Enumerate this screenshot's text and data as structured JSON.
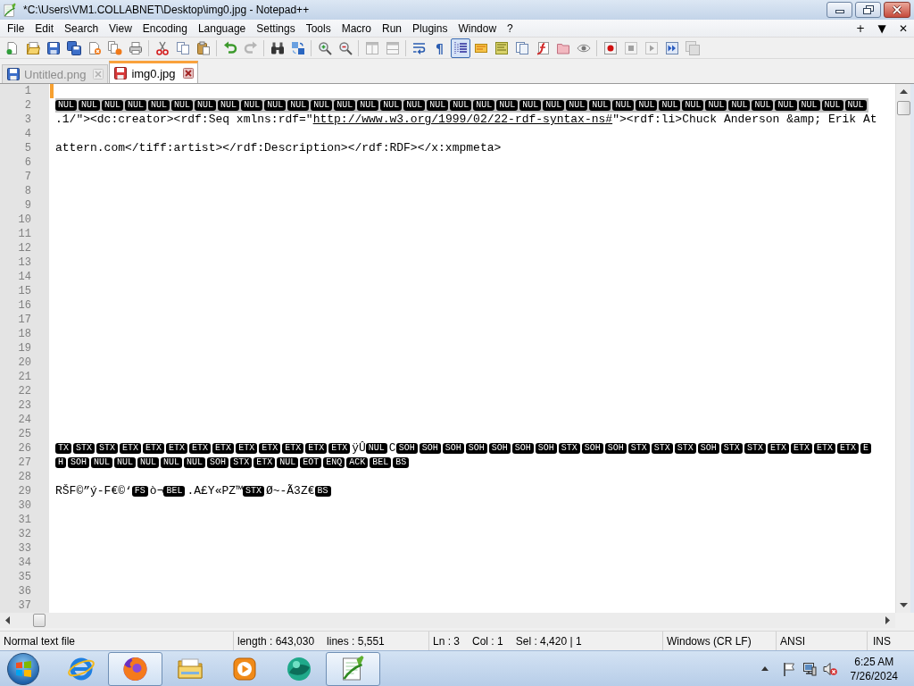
{
  "window": {
    "title": "*C:\\Users\\VM1.COLLABNET\\Desktop\\img0.jpg - Notepad++"
  },
  "menu": {
    "items": [
      "File",
      "Edit",
      "Search",
      "View",
      "Encoding",
      "Language",
      "Settings",
      "Tools",
      "Macro",
      "Run",
      "Plugins",
      "Window",
      "?"
    ],
    "buttons": [
      "+",
      "▼",
      "✕"
    ]
  },
  "toolbar": {
    "groups": [
      {
        "items": [
          {
            "kind": "new",
            "pressed": false,
            "disabled": false
          },
          {
            "kind": "open",
            "pressed": false,
            "disabled": false
          },
          {
            "kind": "save",
            "pressed": false,
            "disabled": false
          },
          {
            "kind": "save_all",
            "pressed": false,
            "disabled": false
          },
          {
            "kind": "close",
            "pressed": false,
            "disabled": false
          },
          {
            "kind": "close_all",
            "pressed": false,
            "disabled": false
          },
          {
            "kind": "print",
            "pressed": false,
            "disabled": false
          }
        ]
      },
      {
        "items": [
          {
            "kind": "cut",
            "pressed": false,
            "disabled": false
          },
          {
            "kind": "copy",
            "pressed": false,
            "disabled": false
          },
          {
            "kind": "paste",
            "pressed": false,
            "disabled": false
          }
        ]
      },
      {
        "items": [
          {
            "kind": "undo",
            "pressed": false,
            "disabled": false
          },
          {
            "kind": "redo",
            "pressed": false,
            "disabled": true
          }
        ]
      },
      {
        "items": [
          {
            "kind": "find",
            "pressed": false,
            "disabled": false
          },
          {
            "kind": "replace",
            "pressed": false,
            "disabled": false
          }
        ]
      },
      {
        "items": [
          {
            "kind": "zoom_in",
            "pressed": false,
            "disabled": false
          },
          {
            "kind": "zoom_out",
            "pressed": false,
            "disabled": false
          }
        ]
      },
      {
        "items": [
          {
            "kind": "sync_v",
            "pressed": false,
            "disabled": true
          },
          {
            "kind": "sync_h",
            "pressed": false,
            "disabled": true
          }
        ]
      },
      {
        "items": [
          {
            "kind": "wrap",
            "pressed": false,
            "disabled": false
          },
          {
            "kind": "glyph",
            "glyph": "¶",
            "pressed": false,
            "disabled": false
          },
          {
            "kind": "indent",
            "pressed": true,
            "disabled": false
          },
          {
            "kind": "udl",
            "pressed": false,
            "disabled": false
          },
          {
            "kind": "doc_map",
            "pressed": false,
            "disabled": false
          },
          {
            "kind": "doc_list",
            "pressed": false,
            "disabled": false
          },
          {
            "kind": "func_list",
            "pressed": false,
            "disabled": false
          },
          {
            "kind": "folder_ws",
            "pressed": false,
            "disabled": false
          },
          {
            "kind": "monitor",
            "pressed": false,
            "disabled": false
          }
        ]
      },
      {
        "items": [
          {
            "kind": "record",
            "pressed": false,
            "disabled": false
          },
          {
            "kind": "stop",
            "pressed": false,
            "disabled": true
          },
          {
            "kind": "play",
            "pressed": false,
            "disabled": true
          },
          {
            "kind": "play_multi",
            "pressed": false,
            "disabled": false
          },
          {
            "kind": "save_macro",
            "pressed": false,
            "disabled": true
          }
        ]
      }
    ]
  },
  "tabs": [
    {
      "label": "Untitled.png",
      "selected": false,
      "modified": false
    },
    {
      "label": "img0.jpg",
      "selected": true,
      "modified": true
    }
  ],
  "lines": [
    {
      "number": "1",
      "selected": false,
      "modified": true
    },
    {
      "number": "2",
      "selected": true,
      "modified": false,
      "segments": [
        {
          "kind": "control",
          "text": "NUL"
        },
        {
          "kind": "control",
          "text": "NUL"
        },
        {
          "kind": "control",
          "text": "NUL"
        },
        {
          "kind": "control",
          "text": "NUL"
        },
        {
          "kind": "control",
          "text": "NUL"
        },
        {
          "kind": "control",
          "text": "NUL"
        },
        {
          "kind": "control",
          "text": "NUL"
        },
        {
          "kind": "control",
          "text": "NUL"
        },
        {
          "kind": "control",
          "text": "NUL"
        },
        {
          "kind": "control",
          "text": "NUL"
        },
        {
          "kind": "control",
          "text": "NUL"
        },
        {
          "kind": "control",
          "text": "NUL"
        },
        {
          "kind": "control",
          "text": "NUL"
        },
        {
          "kind": "control",
          "text": "NUL"
        },
        {
          "kind": "control",
          "text": "NUL"
        },
        {
          "kind": "control",
          "text": "NUL"
        },
        {
          "kind": "control",
          "text": "NUL"
        },
        {
          "kind": "control",
          "text": "NUL"
        },
        {
          "kind": "control",
          "text": "NUL"
        },
        {
          "kind": "control",
          "text": "NUL"
        },
        {
          "kind": "control",
          "text": "NUL"
        },
        {
          "kind": "control",
          "text": "NUL"
        },
        {
          "kind": "control",
          "text": "NUL"
        },
        {
          "kind": "control",
          "text": "NUL"
        },
        {
          "kind": "control",
          "text": "NUL"
        },
        {
          "kind": "control",
          "text": "NUL"
        },
        {
          "kind": "control",
          "text": "NUL"
        },
        {
          "kind": "control",
          "text": "NUL"
        },
        {
          "kind": "control",
          "text": "NUL"
        },
        {
          "kind": "control",
          "text": "NUL"
        },
        {
          "kind": "control",
          "text": "NUL"
        },
        {
          "kind": "control",
          "text": "NUL"
        },
        {
          "kind": "control",
          "text": "NUL"
        },
        {
          "kind": "control",
          "text": "NUL"
        },
        {
          "kind": "control",
          "text": "NUL"
        }
      ]
    },
    {
      "number": "3",
      "selected": false,
      "modified": false,
      "segments": [
        {
          "kind": "text",
          "text": ".1/\"><dc:creator><rdf:Seq xmlns:rdf=\""
        },
        {
          "kind": "link",
          "text": "http://www.w3.org/1999/02/22-rdf-syntax-ns#"
        },
        {
          "kind": "text",
          "text": "\"><rdf:li>Chuck Anderson &amp; Erik At"
        }
      ]
    },
    {
      "number": "4",
      "selected": false,
      "modified": false
    },
    {
      "number": "5",
      "selected": false,
      "modified": false,
      "segments": [
        {
          "kind": "text",
          "text": "attern.com</tiff:artist></rdf:Description></rdf:RDF></x:xmpmeta>"
        }
      ]
    },
    {
      "number": "6",
      "selected": false,
      "modified": false
    },
    {
      "number": "7",
      "selected": false,
      "modified": false
    },
    {
      "number": "8",
      "selected": false,
      "modified": false
    },
    {
      "number": "9",
      "selected": false,
      "modified": false
    },
    {
      "number": "10",
      "selected": false,
      "modified": false
    },
    {
      "number": "11",
      "selected": false,
      "modified": false
    },
    {
      "number": "12",
      "selected": false,
      "modified": false
    },
    {
      "number": "13",
      "selected": false,
      "modified": false
    },
    {
      "number": "14",
      "selected": false,
      "modified": false
    },
    {
      "number": "15",
      "selected": false,
      "modified": false
    },
    {
      "number": "16",
      "selected": false,
      "modified": false
    },
    {
      "number": "17",
      "selected": false,
      "modified": false
    },
    {
      "number": "18",
      "selected": false,
      "modified": false
    },
    {
      "number": "19",
      "selected": false,
      "modified": false
    },
    {
      "number": "20",
      "selected": false,
      "modified": false
    },
    {
      "number": "21",
      "selected": false,
      "modified": false
    },
    {
      "number": "22",
      "selected": false,
      "modified": false
    },
    {
      "number": "23",
      "selected": false,
      "modified": false
    },
    {
      "number": "24",
      "selected": false,
      "modified": false
    },
    {
      "number": "25",
      "selected": false,
      "modified": false
    },
    {
      "number": "26",
      "selected": false,
      "modified": false,
      "segments": [
        {
          "kind": "control",
          "text": "TX"
        },
        {
          "kind": "control",
          "text": "STX"
        },
        {
          "kind": "control",
          "text": "STX"
        },
        {
          "kind": "control",
          "text": "ETX"
        },
        {
          "kind": "control",
          "text": "ETX"
        },
        {
          "kind": "control",
          "text": "ETX"
        },
        {
          "kind": "control",
          "text": "ETX"
        },
        {
          "kind": "control",
          "text": "ETX"
        },
        {
          "kind": "control",
          "text": "ETX"
        },
        {
          "kind": "control",
          "text": "ETX"
        },
        {
          "kind": "control",
          "text": "ETX"
        },
        {
          "kind": "control",
          "text": "ETX"
        },
        {
          "kind": "control",
          "text": "ETX"
        },
        {
          "kind": "text",
          "text": "ÿÛ"
        },
        {
          "kind": "control",
          "text": "NUL"
        },
        {
          "kind": "text",
          "text": "C"
        },
        {
          "kind": "control",
          "text": "SOH"
        },
        {
          "kind": "control",
          "text": "SOH"
        },
        {
          "kind": "control",
          "text": "SOH"
        },
        {
          "kind": "control",
          "text": "SOH"
        },
        {
          "kind": "control",
          "text": "SOH"
        },
        {
          "kind": "control",
          "text": "SOH"
        },
        {
          "kind": "control",
          "text": "SOH"
        },
        {
          "kind": "control",
          "text": "STX"
        },
        {
          "kind": "control",
          "text": "SOH"
        },
        {
          "kind": "control",
          "text": "SOH"
        },
        {
          "kind": "control",
          "text": "STX"
        },
        {
          "kind": "control",
          "text": "STX"
        },
        {
          "kind": "control",
          "text": "STX"
        },
        {
          "kind": "control",
          "text": "SOH"
        },
        {
          "kind": "control",
          "text": "STX"
        },
        {
          "kind": "control",
          "text": "STX"
        },
        {
          "kind": "control",
          "text": "ETX"
        },
        {
          "kind": "control",
          "text": "ETX"
        },
        {
          "kind": "control",
          "text": "ETX"
        },
        {
          "kind": "control",
          "text": "ETX"
        },
        {
          "kind": "control",
          "text": "E"
        }
      ]
    },
    {
      "number": "27",
      "selected": false,
      "modified": false,
      "segments": [
        {
          "kind": "control",
          "text": "H"
        },
        {
          "kind": "control",
          "text": "SOH"
        },
        {
          "kind": "control",
          "text": "NUL"
        },
        {
          "kind": "control",
          "text": "NUL"
        },
        {
          "kind": "control",
          "text": "NUL"
        },
        {
          "kind": "control",
          "text": "NUL"
        },
        {
          "kind": "control",
          "text": "NUL"
        },
        {
          "kind": "control",
          "text": "SOH"
        },
        {
          "kind": "control",
          "text": "STX"
        },
        {
          "kind": "control",
          "text": "ETX"
        },
        {
          "kind": "control",
          "text": "NUL"
        },
        {
          "kind": "control",
          "text": "EOT"
        },
        {
          "kind": "control",
          "text": "ENQ"
        },
        {
          "kind": "control",
          "text": "ACK"
        },
        {
          "kind": "control",
          "text": "BEL"
        },
        {
          "kind": "control",
          "text": "BS"
        }
      ]
    },
    {
      "number": "28",
      "selected": false,
      "modified": false
    },
    {
      "number": "29",
      "selected": false,
      "modified": false,
      "segments": [
        {
          "kind": "text",
          "text": "RŠF©”ý-F€©‘"
        },
        {
          "kind": "control",
          "text": "FS"
        },
        {
          "kind": "text",
          "text": "ò¬"
        },
        {
          "kind": "control",
          "text": "BEL"
        },
        {
          "kind": "text",
          "text": ".A£Y«PZ™"
        },
        {
          "kind": "control",
          "text": "STX"
        },
        {
          "kind": "text",
          "text": "Ø~-Ã3Z€"
        },
        {
          "kind": "control",
          "text": "BS"
        }
      ]
    },
    {
      "number": "30",
      "selected": false,
      "modified": false
    },
    {
      "number": "31",
      "selected": false,
      "modified": false
    },
    {
      "number": "32",
      "selected": false,
      "modified": false
    },
    {
      "number": "33",
      "selected": false,
      "modified": false
    },
    {
      "number": "34",
      "selected": false,
      "modified": false
    },
    {
      "number": "35",
      "selected": false,
      "modified": false
    },
    {
      "number": "36",
      "selected": false,
      "modified": false
    },
    {
      "number": "37",
      "selected": false,
      "modified": false
    }
  ],
  "status_bar": [
    {
      "texts": [
        "Normal text file"
      ]
    },
    {
      "texts": [
        "length : 643,030",
        "lines : 5,551"
      ]
    },
    {
      "texts": [
        "Ln : 3",
        "Col : 1",
        "Sel : 4,420 | 1"
      ]
    },
    {
      "texts": [
        "Windows (CR LF)"
      ]
    },
    {
      "texts": [
        "ANSI"
      ]
    },
    {
      "texts": [
        "INS"
      ]
    }
  ],
  "taskbar": {
    "apps": [
      {
        "kind": "browser_e",
        "running": false
      },
      {
        "kind": "browser_fox",
        "running": true
      },
      {
        "kind": "folder",
        "running": false
      },
      {
        "kind": "media",
        "running": false
      },
      {
        "kind": "sphere",
        "running": false
      },
      {
        "kind": "notepad",
        "running": true
      }
    ],
    "clock": {
      "time": "6:25 AM",
      "date": "7/26/2024"
    }
  }
}
